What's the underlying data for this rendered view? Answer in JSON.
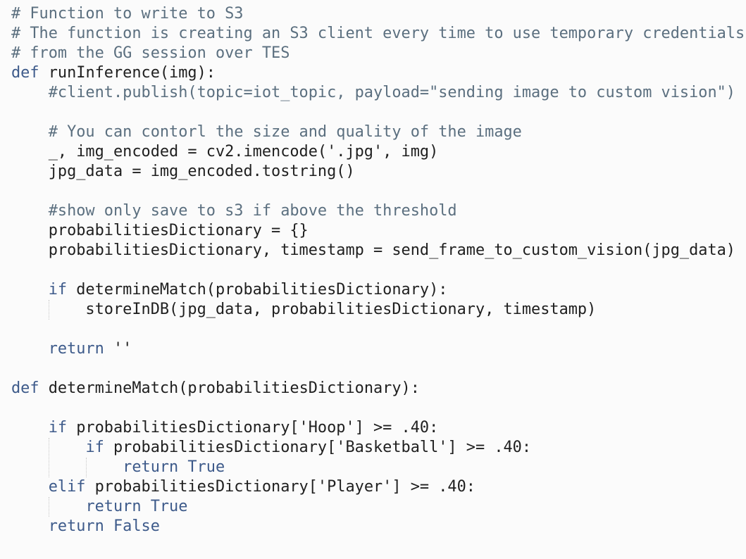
{
  "editor": {
    "lines": [
      "# Function to write to S3",
      "# The function is creating an S3 client every time to use temporary credentials",
      "# from the GG session over TES",
      "def runInference(img):",
      "    #client.publish(topic=iot_topic, payload=\"sending image to custom vision\")",
      "",
      "    # You can contorl the size and quality of the image",
      "    _, img_encoded = cv2.imencode('.jpg', img)",
      "    jpg_data = img_encoded.tostring()",
      "",
      "    #show only save to s3 if above the threshold",
      "    probabilitiesDictionary = {}",
      "    probabilitiesDictionary, timestamp = send_frame_to_custom_vision(jpg_data)",
      "",
      "    if determineMatch(probabilitiesDictionary):",
      "        storeInDB(jpg_data, probabilitiesDictionary, timestamp)",
      "",
      "    return ''",
      "",
      "def determineMatch(probabilitiesDictionary):",
      "",
      "    if probabilitiesDictionary['Hoop'] >= .40:",
      "        if probabilitiesDictionary['Basketball'] >= .40:",
      "            return True",
      "    elif probabilitiesDictionary['Player'] >= .40:",
      "        return True",
      "    return False"
    ]
  }
}
